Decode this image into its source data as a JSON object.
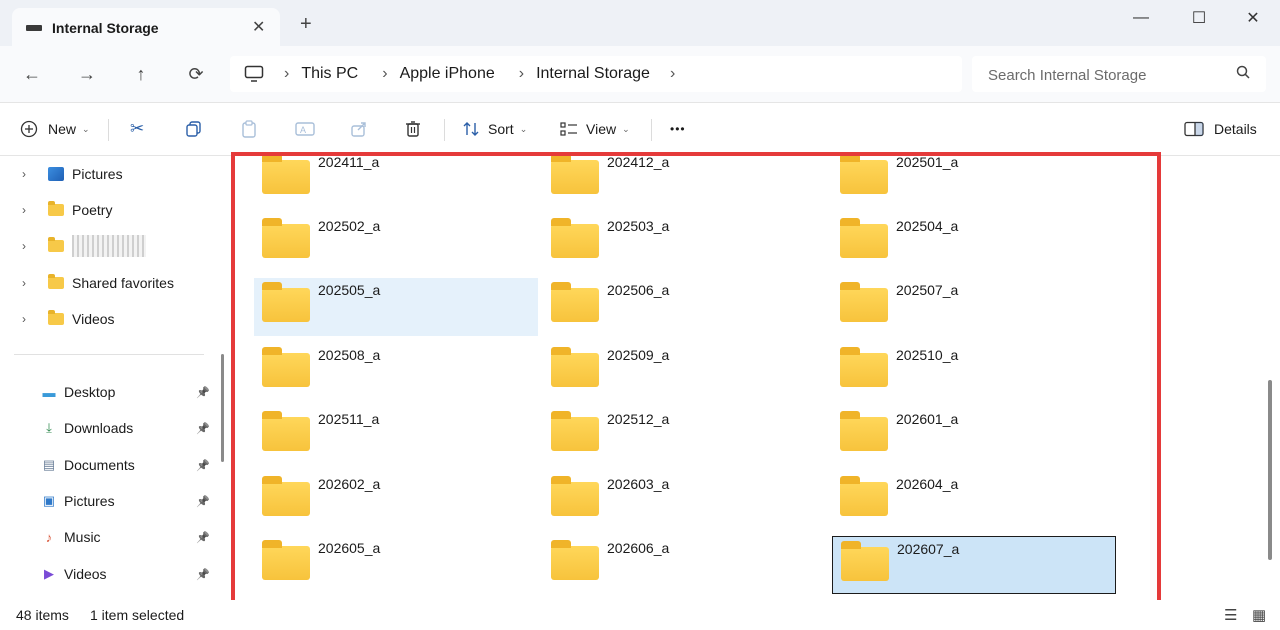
{
  "window": {
    "tab_title": "Internal Storage",
    "tab_close": "✕",
    "new_tab": "+",
    "minimize": "—",
    "maximize": "☐",
    "close": "✕"
  },
  "nav": {
    "back": "←",
    "forward": "→",
    "up": "↑",
    "refresh": "⟳",
    "breadcrumb": [
      "This PC",
      "Apple iPhone",
      "Internal Storage"
    ],
    "search_placeholder": "Search Internal Storage"
  },
  "toolbar": {
    "new_label": "New",
    "sort_label": "Sort",
    "view_label": "View",
    "more": "•••",
    "details_label": "Details"
  },
  "sidebar": {
    "tree": [
      {
        "label": "Pictures",
        "icon": "pictures-icon"
      },
      {
        "label": "Poetry",
        "icon": "folder-icon"
      },
      {
        "label": "",
        "icon": "folder-icon",
        "redacted": true
      },
      {
        "label": "Shared favorites",
        "icon": "folder-icon"
      },
      {
        "label": "Videos",
        "icon": "folder-icon"
      }
    ],
    "quick_access": [
      {
        "label": "Desktop",
        "icon": "desktop-icon"
      },
      {
        "label": "Downloads",
        "icon": "download-icon"
      },
      {
        "label": "Documents",
        "icon": "document-icon"
      },
      {
        "label": "Pictures",
        "icon": "pictures-icon"
      },
      {
        "label": "Music",
        "icon": "music-icon"
      },
      {
        "label": "Videos",
        "icon": "videos-icon"
      }
    ]
  },
  "folders": [
    "202411_a",
    "202412_a",
    "202501_a",
    "202502_a",
    "202503_a",
    "202504_a",
    "202505_a",
    "202506_a",
    "202507_a",
    "202508_a",
    "202509_a",
    "202510_a",
    "202511_a",
    "202512_a",
    "202601_a",
    "202602_a",
    "202603_a",
    "202604_a",
    "202605_a",
    "202606_a",
    "202607_a"
  ],
  "hover_folder": "202505_a",
  "selected_folder": "202607_a",
  "status": {
    "items": "48 items",
    "selected": "1 item selected"
  },
  "colors": {
    "highlight_box": "#e53a3a",
    "folder": "#f7c948",
    "selection": "#cce4f7"
  }
}
